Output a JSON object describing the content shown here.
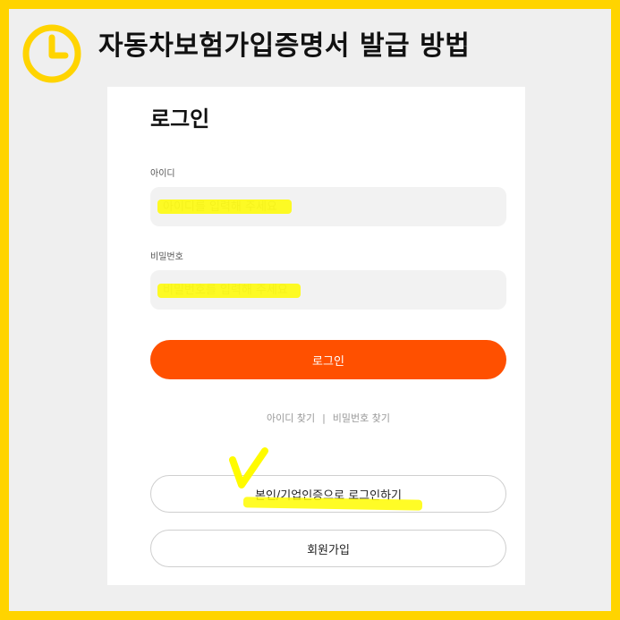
{
  "banner": {
    "title": "자동차보험가입증명서 발급 방법",
    "icon": "clock-icon",
    "accent_color": "#ffd400"
  },
  "login": {
    "title": "로그인",
    "id_label": "아이디",
    "id_placeholder": "아이디를 입력해 주세요",
    "password_label": "비밀번호",
    "password_placeholder": "비밀번호를 입력해 주세요",
    "submit_label": "로그인",
    "submit_color": "#ff5000",
    "find_id": "아이디 찾기",
    "separator": "|",
    "find_password": "비밀번호 찾기",
    "cert_login": "본인/기업인증으로 로그인하기",
    "signup": "회원가입"
  },
  "annotations": {
    "highlight_color": "#fffb00",
    "check_icon": "checkmark-icon"
  }
}
